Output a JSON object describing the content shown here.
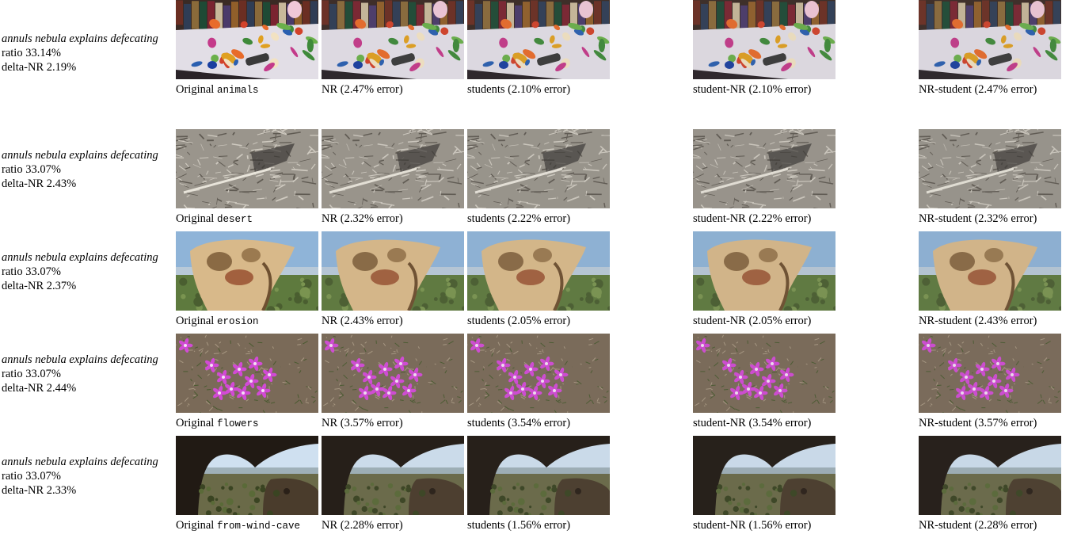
{
  "rows": [
    {
      "phrase": "annuls nebula explains defecating",
      "ratio": "ratio 33.14%",
      "delta": "delta-NR 2.19%",
      "original_label": "Original",
      "name": "animals",
      "captions": [
        "NR (2.47% error)",
        "students (2.10% error)",
        "student-NR (2.10% error)",
        "NR-student (2.47% error)"
      ],
      "scene": "animals"
    },
    {
      "phrase": "annuls nebula explains defecating",
      "ratio": "ratio 33.07%",
      "delta": "delta-NR 2.43%",
      "original_label": "Original",
      "name": "desert",
      "captions": [
        "NR (2.32% error)",
        "students (2.22% error)",
        "student-NR (2.22% error)",
        "NR-student (2.32% error)"
      ],
      "scene": "desert"
    },
    {
      "phrase": "annuls nebula explains defecating",
      "ratio": "ratio 33.07%",
      "delta": "delta-NR 2.37%",
      "original_label": "Original",
      "name": "erosion",
      "captions": [
        "NR (2.43% error)",
        "students (2.05% error)",
        "student-NR (2.05% error)",
        "NR-student (2.43% error)"
      ],
      "scene": "erosion"
    },
    {
      "phrase": "annuls nebula explains defecating",
      "ratio": "ratio 33.07%",
      "delta": "delta-NR 2.44%",
      "original_label": "Original",
      "name": "flowers",
      "captions": [
        "NR (3.57% error)",
        "students (3.54% error)",
        "student-NR (3.54% error)",
        "NR-student (3.57% error)"
      ],
      "scene": "flowers"
    },
    {
      "phrase": "annuls nebula explains defecating",
      "ratio": "ratio 33.07%",
      "delta": "delta-NR 2.33%",
      "original_label": "Original",
      "name": "from-wind-cave",
      "captions": [
        "NR (2.28% error)",
        "students (1.56% error)",
        "student-NR (1.56% error)",
        "NR-student (2.28% error)"
      ],
      "scene": "cave"
    }
  ]
}
